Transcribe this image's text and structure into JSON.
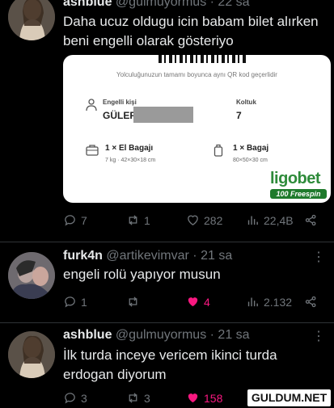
{
  "tweets": [
    {
      "name": "ashblue",
      "handle": "@gulmuyormus",
      "time": "· 22 sa",
      "text_line1": "Daha ucuz oldugu icin babam bilet alırken",
      "text_line2": "beni engelli olarak gösteriyo",
      "replies": "7",
      "retweets": "1",
      "likes": "282",
      "views": "22,4B",
      "liked": false
    },
    {
      "name": "furk4n",
      "handle": "@artikevimvar",
      "time": "· 21 sa",
      "text_line1": "engeli rolü yapıyor musun",
      "replies": "1",
      "retweets": "",
      "likes": "4",
      "views": "2.132",
      "liked": true
    },
    {
      "name": "ashblue",
      "handle": "@gulmuyormus",
      "time": "· 21 sa",
      "text_line1": "İlk turda inceye vericem ikinci turda",
      "text_line2": "erdogan diyorum",
      "replies": "3",
      "retweets": "3",
      "likes": "158",
      "views": "",
      "liked": true
    }
  ],
  "ticket": {
    "subtitle": "Yolculuğunuzun tamamı boyunca aynı QR kod geçerlidir",
    "passenger_label": "Engelli kişi",
    "passenger_name": "GÜLER",
    "seat_label": "Koltuk",
    "seat_value": "7",
    "hand_bag": "1 × El Bagajı",
    "hand_bag_detail": "7 kg · 42×30×18 cm",
    "bag": "1 × Bagaj",
    "bag_detail": "80×50×30 cm"
  },
  "ad": {
    "logo": "ligobet",
    "badge": "100 Freespin"
  },
  "watermark": "GULDUM.NET",
  "colors": {
    "like_pink": "#f91880",
    "muted": "#71767b",
    "brand_green": "#2e8b3a"
  }
}
